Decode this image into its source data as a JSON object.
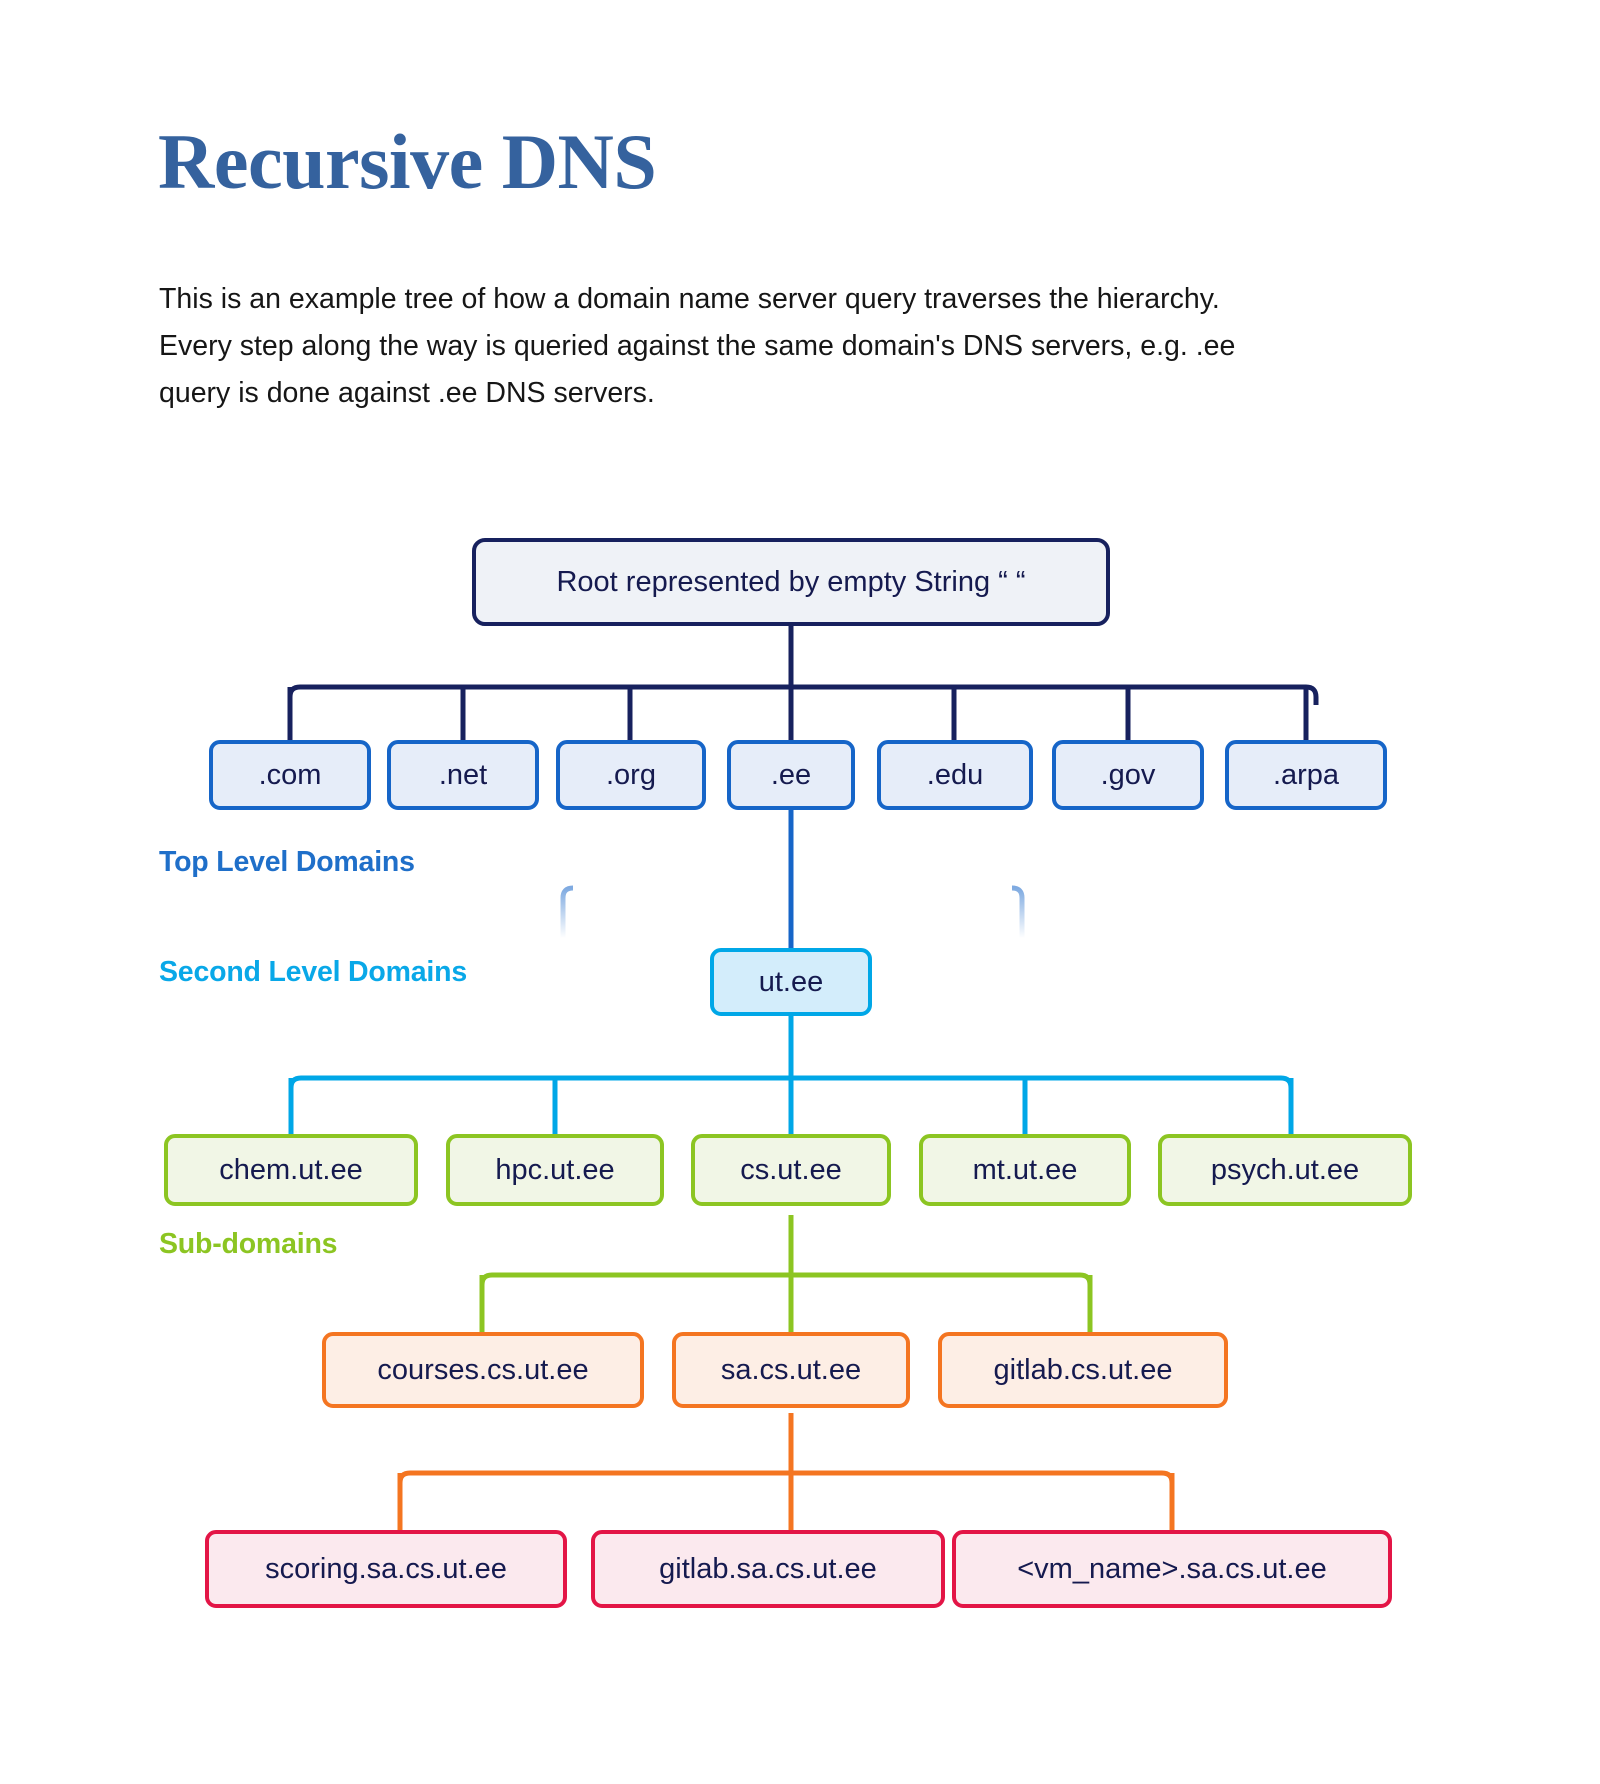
{
  "header": {
    "title": "Recursive DNS",
    "paragraph": "This is an example tree of how a domain name server query traverses the hierarchy. Every step along the way is queried against the same domain's DNS servers, e.g. .ee query is done against .ee DNS servers."
  },
  "tier_labels": {
    "top_level": "Top Level Domains",
    "second_level": "Second Level Domains",
    "sub_domains": "Sub-domains"
  },
  "colors": {
    "title": "#35629e",
    "root_border": "#17215e",
    "tld_border": "#1665c8",
    "sld_border": "#00a7e7",
    "sub_border": "#8cc522",
    "sub2_border": "#f47521",
    "sub3_border": "#e31546",
    "node_text": "#151a4f",
    "body_text": "#161616"
  },
  "tree": {
    "root": {
      "label": "Root represented by empty String “ “"
    },
    "tlds": [
      {
        "label": ".com"
      },
      {
        "label": ".net"
      },
      {
        "label": ".org"
      },
      {
        "label": ".ee"
      },
      {
        "label": ".edu"
      },
      {
        "label": ".gov"
      },
      {
        "label": ".arpa"
      }
    ],
    "second_level": [
      {
        "label": "ut.ee"
      }
    ],
    "sub_domains": [
      {
        "label": "chem.ut.ee"
      },
      {
        "label": "hpc.ut.ee"
      },
      {
        "label": "cs.ut.ee"
      },
      {
        "label": "mt.ut.ee"
      },
      {
        "label": "psych.ut.ee"
      }
    ],
    "cs_children": [
      {
        "label": "courses.cs.ut.ee"
      },
      {
        "label": "sa.cs.ut.ee"
      },
      {
        "label": "gitlab.cs.ut.ee"
      }
    ],
    "sa_children": [
      {
        "label": "scoring.sa.cs.ut.ee"
      },
      {
        "label": "gitlab.sa.cs.ut.ee"
      },
      {
        "label": "<vm_name>.sa.cs.ut.ee"
      }
    ]
  }
}
